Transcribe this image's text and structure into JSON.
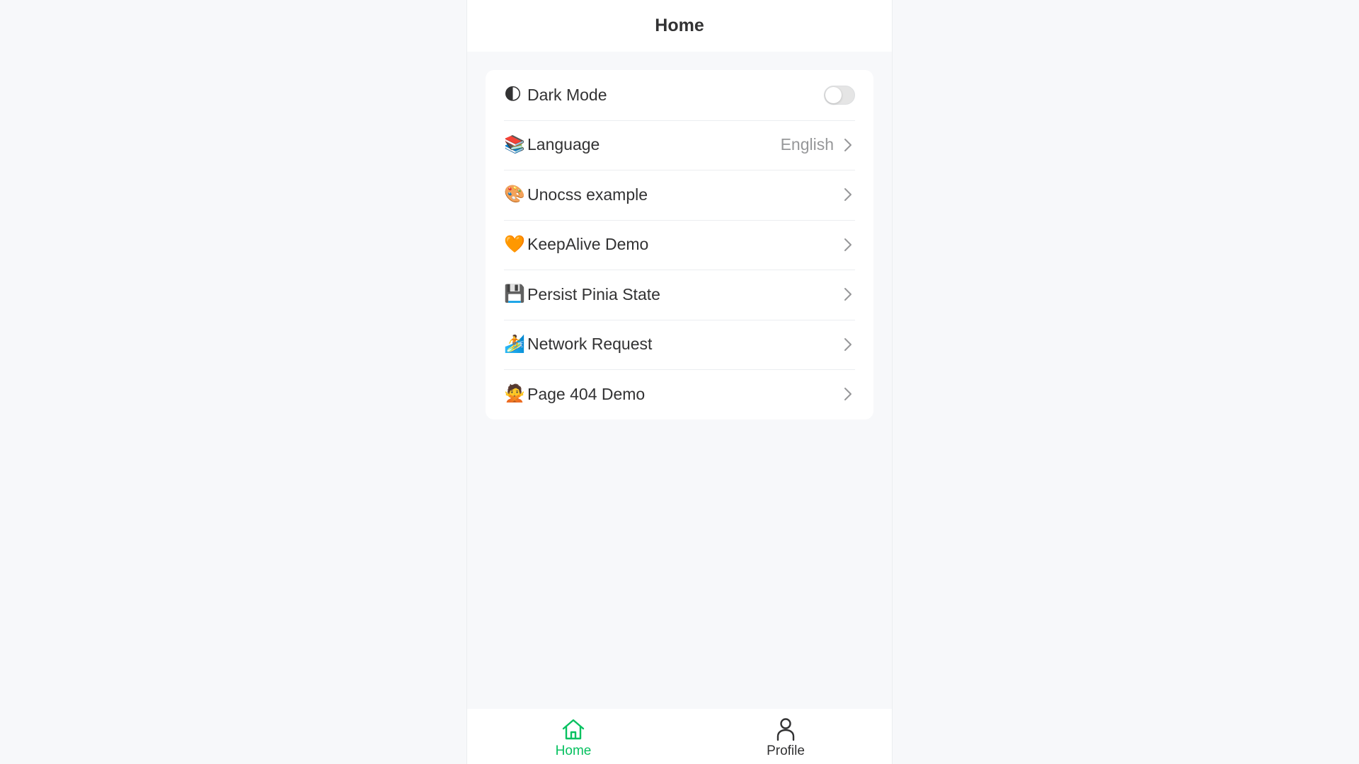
{
  "header": {
    "title": "Home"
  },
  "colors": {
    "accent": "#07c160",
    "text": "#323233",
    "muted": "#969799"
  },
  "settings": {
    "items": [
      {
        "emoji": "🌓",
        "label": "Dark Mode",
        "control": "switch",
        "checked": false
      },
      {
        "emoji": "📚",
        "label": "Language",
        "value": "English",
        "control": "arrow"
      },
      {
        "emoji": "🎨",
        "label": "Unocss example",
        "control": "arrow"
      },
      {
        "emoji": "🧡",
        "label": "KeepAlive Demo",
        "control": "arrow"
      },
      {
        "emoji": "💾",
        "label": "Persist Pinia State",
        "control": "arrow"
      },
      {
        "emoji": "🏄",
        "label": "Network Request",
        "control": "arrow"
      },
      {
        "emoji": "🙅",
        "label": "Page 404 Demo",
        "control": "arrow"
      }
    ]
  },
  "tabbar": {
    "tabs": [
      {
        "label": "Home",
        "icon": "home-icon",
        "active": true
      },
      {
        "label": "Profile",
        "icon": "user-icon",
        "active": false
      }
    ]
  }
}
